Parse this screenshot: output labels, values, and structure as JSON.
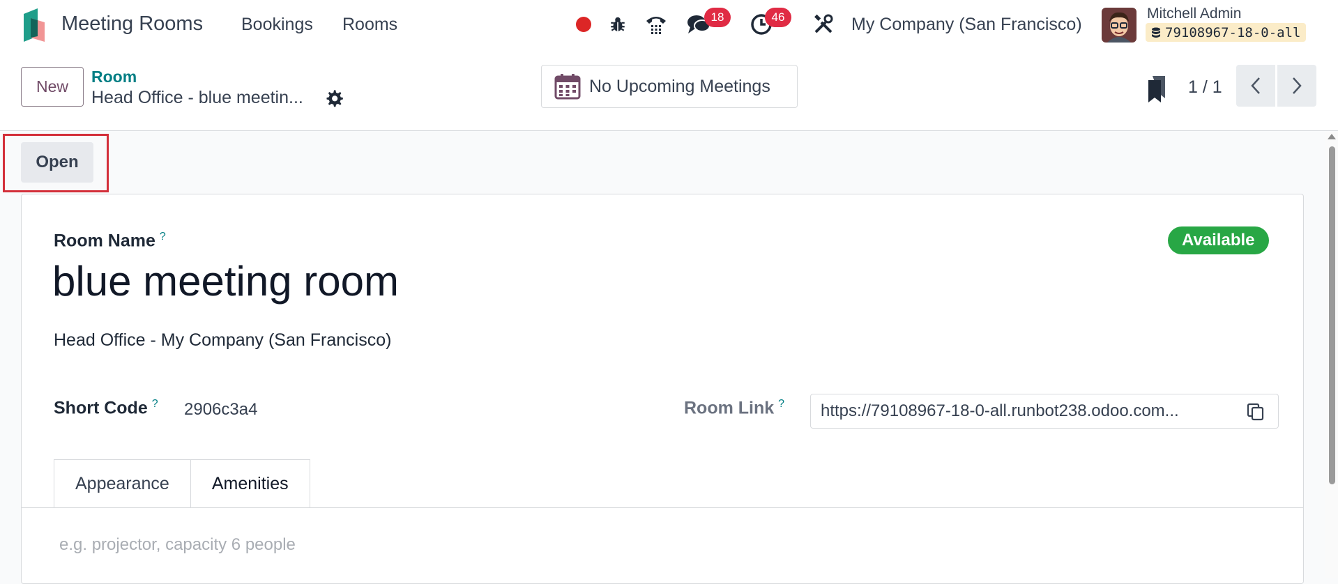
{
  "navbar": {
    "app_title": "Meeting Rooms",
    "menu": [
      "Bookings",
      "Rooms"
    ],
    "messages_count": "18",
    "activities_count": "46",
    "company": "My Company (San Francisco)",
    "user_name": "Mitchell Admin",
    "database": "79108967-18-0-all"
  },
  "control": {
    "new_label": "New",
    "breadcrumb_parent": "Room",
    "breadcrumb_current": "Head Office - blue meetin...",
    "meetings_button": "No Upcoming Meetings",
    "pager": "1 / 1"
  },
  "statusbar": {
    "open_label": "Open"
  },
  "form": {
    "room_name_label": "Room Name",
    "help_mark": "?",
    "room_name": "blue meeting room",
    "location": "Head Office - My Company (San Francisco)",
    "status": "Available",
    "short_code_label": "Short Code",
    "short_code": "2906c3a4",
    "room_link_label": "Room Link",
    "room_link": "https://79108967-18-0-all.runbot238.odoo.com...",
    "tabs": [
      "Appearance",
      "Amenities"
    ],
    "amenities_placeholder": "e.g. projector, capacity 6 people"
  },
  "colors": {
    "brand": "#714b67",
    "link": "#017e84",
    "badge": "#e02b44",
    "available": "#28a745",
    "highlight": "#d32f3a"
  }
}
